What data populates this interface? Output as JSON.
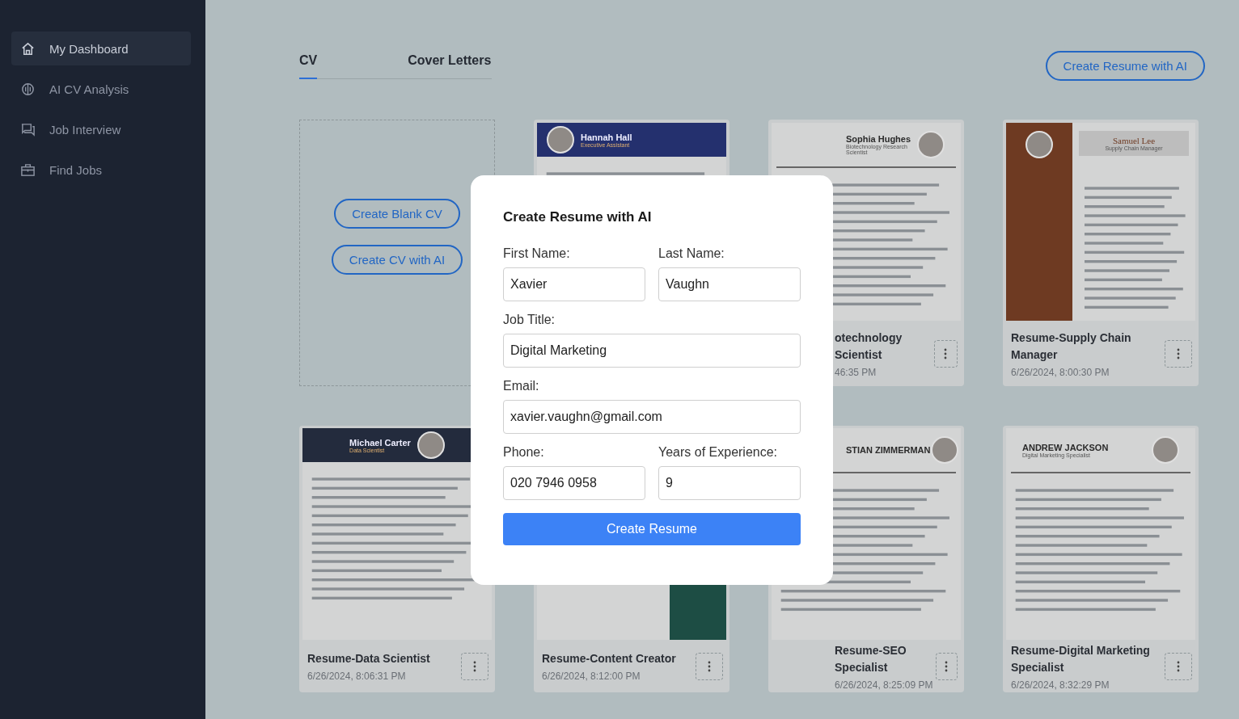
{
  "sidebar": {
    "items": [
      {
        "label": "My Dashboard",
        "selected": true
      },
      {
        "label": "AI CV Analysis",
        "selected": false
      },
      {
        "label": "Job Interview",
        "selected": false
      },
      {
        "label": "Find Jobs",
        "selected": false
      }
    ]
  },
  "tabs": [
    {
      "label": "CV",
      "selected": true
    },
    {
      "label": "Cover Letters",
      "selected": false
    }
  ],
  "header_button": "Create Resume with AI",
  "new_card": {
    "buttons": [
      "Create Blank CV",
      "Create CV with AI"
    ]
  },
  "cards": [
    {
      "kind": "resume",
      "thumbnail": {
        "kind": "banner",
        "name": "Hannah Hall",
        "role": "Executive Assistant"
      }
    },
    {
      "kind": "resume",
      "thumbnail": {
        "kind": "plain",
        "name": "Sophia Hughes",
        "role": "Biotechnology Research Scientist"
      },
      "title": "otechnology Scientist",
      "date": "46:35 PM",
      "clipped": true
    },
    {
      "kind": "resume",
      "thumbnail": {
        "kind": "sidebar",
        "name": "Samuel Lee",
        "role": "Supply Chain Manager"
      },
      "title": "Resume-Supply Chain Manager",
      "date": "6/26/2024, 8:00:30 PM",
      "clipped": false
    },
    {
      "kind": "resume",
      "thumbnail": {
        "kind": "banner",
        "name": "Michael Carter",
        "role": "Data Scientist"
      },
      "title": "Resume-Data Scientist",
      "date": "6/26/2024, 8:06:31 PM",
      "clipped": false
    },
    {
      "kind": "resume",
      "thumbnail": {
        "kind": "green"
      },
      "title": "Resume-Content Creator",
      "date": "6/26/2024, 8:12:00 PM",
      "clipped": false
    },
    {
      "kind": "resume",
      "thumbnail": {
        "kind": "plain",
        "name": "STIAN ZIMMERMAN"
      },
      "title": "Resume-SEO Specialist",
      "date": "6/26/2024, 8:25:09 PM",
      "clipped": true
    },
    {
      "kind": "resume",
      "thumbnail": {
        "kind": "plain",
        "name": "ANDREW JACKSON",
        "role": "Digital Marketing Specialist"
      },
      "title": "Resume-Digital Marketing Specialist",
      "date": "6/26/2024, 8:32:29 PM",
      "clipped": false
    }
  ],
  "modal": {
    "title": "Create Resume with AI",
    "rows": [
      [
        {
          "label": "First Name:",
          "value": "Xavier"
        },
        {
          "label": "Last Name:",
          "value": "Vaughn"
        }
      ],
      [
        {
          "label": "Job Title:",
          "value": "Digital Marketing"
        }
      ],
      [
        {
          "label": "Email:",
          "value": "xavier.vaughn@gmail.com"
        }
      ],
      [
        {
          "label": "Phone:",
          "value": "020 7946 0958"
        },
        {
          "label": "Years of Experience:",
          "value": "9"
        }
      ]
    ],
    "submit": "Create Resume"
  }
}
